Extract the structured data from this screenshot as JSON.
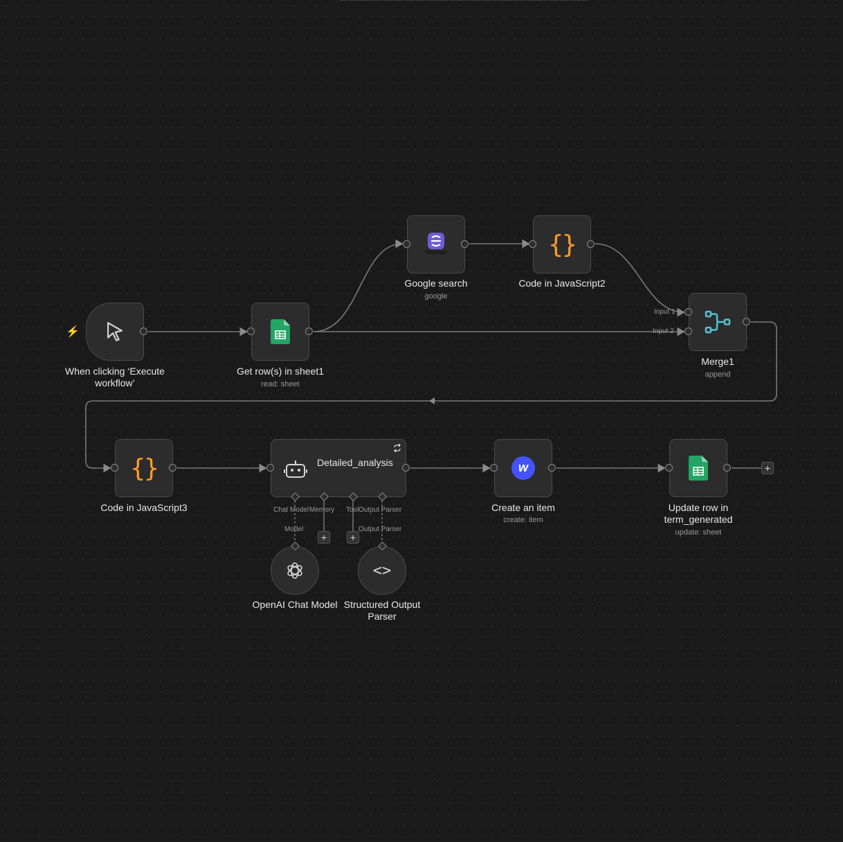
{
  "nodes": {
    "trigger": {
      "label": "When clicking ‘Execute workflow’"
    },
    "get_rows": {
      "label": "Get row(s) in sheet1",
      "sub": "read: sheet"
    },
    "google_search": {
      "label": "Google search",
      "sub": "google",
      "logo_text": "SerpApi"
    },
    "code2": {
      "label": "Code in JavaScript2",
      "icon_text": "{}"
    },
    "merge": {
      "label": "Merge1",
      "sub": "append",
      "input1": "Input 1",
      "input2": "Input 2"
    },
    "code3": {
      "label": "Code in JavaScript3",
      "icon_text": "{}"
    },
    "agent": {
      "title": "Detailed_analysis",
      "slot_chat_model": "Chat Model",
      "slot_memory": "Memory",
      "slot_tool": "Tool",
      "slot_output_parser": "Output Parser",
      "under_model": "Model",
      "under_output_parser": "Output Parser"
    },
    "create_item": {
      "label": "Create an item",
      "sub": "create: item",
      "logo_text": "w"
    },
    "update_row": {
      "label": "Update row in term_generated",
      "sub": "update: sheet"
    },
    "openai": {
      "label": "OpenAI Chat Model"
    },
    "parser": {
      "label": "Structured Output Parser",
      "icon_text": "<>"
    }
  },
  "plus_symbol": "+",
  "colors": {
    "background": "#1a1a1a",
    "node": "#2c2c2c",
    "edge": "#8a8a8a",
    "code_orange": "#ff9b26",
    "sheets_green": "#23a566",
    "merge_teal": "#54c1d3",
    "serpapi_purple": "#6e5bd8",
    "webflow_blue": "#4353ff",
    "trigger_red": "#ff6d6d"
  }
}
